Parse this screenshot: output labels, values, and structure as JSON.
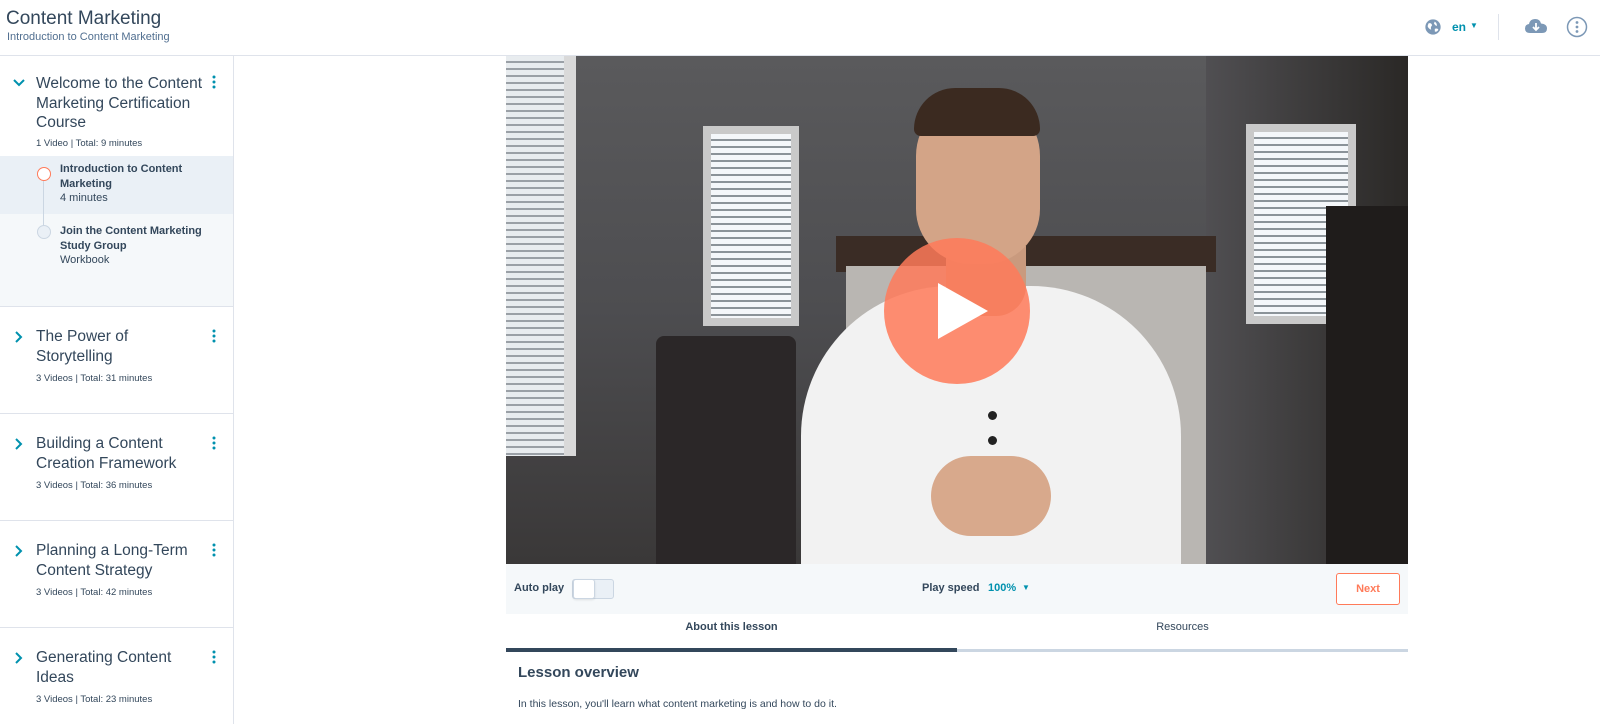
{
  "header": {
    "title": "Content Marketing",
    "subtitle": "Introduction to Content Marketing",
    "language": "en"
  },
  "sidebar": {
    "sections": [
      {
        "title": "Welcome to the Content Marketing Certification Course",
        "meta": "1 Video | Total: 9 minutes",
        "expanded": true,
        "lessons": [
          {
            "title": "Introduction to Content Marketing",
            "meta": "4 minutes",
            "status": "current"
          },
          {
            "title": "Join the Content Marketing Study Group",
            "meta": "Workbook",
            "status": "not-started"
          }
        ]
      },
      {
        "title": "The Power of Storytelling",
        "meta": "3 Videos | Total: 31 minutes",
        "expanded": false
      },
      {
        "title": "Building a Content Creation Framework",
        "meta": "3 Videos | Total: 36 minutes",
        "expanded": false
      },
      {
        "title": "Planning a Long-Term Content Strategy",
        "meta": "3 Videos | Total: 42 minutes",
        "expanded": false
      },
      {
        "title": "Generating Content Ideas",
        "meta": "3 Videos | Total: 23 minutes",
        "expanded": false
      }
    ]
  },
  "player": {
    "autoplay_label": "Auto play",
    "autoplay_on": false,
    "speed_label": "Play speed",
    "speed_value": "100%",
    "next_label": "Next"
  },
  "tabs": [
    {
      "label": "About this lesson",
      "active": true
    },
    {
      "label": "Resources",
      "active": false
    }
  ],
  "overview": {
    "title": "Lesson overview",
    "text": "In this lesson, you'll learn what content marketing is and how to do it."
  },
  "colors": {
    "accent": "#ff7a59",
    "link": "#0091ae",
    "text": "#33475b",
    "border": "#dfe3eb"
  },
  "icons": [
    "globe-icon",
    "cloud-download-icon",
    "more-vertical-icon",
    "chevron-down-icon",
    "chevron-right-icon",
    "kebab-icon",
    "play-icon"
  ]
}
